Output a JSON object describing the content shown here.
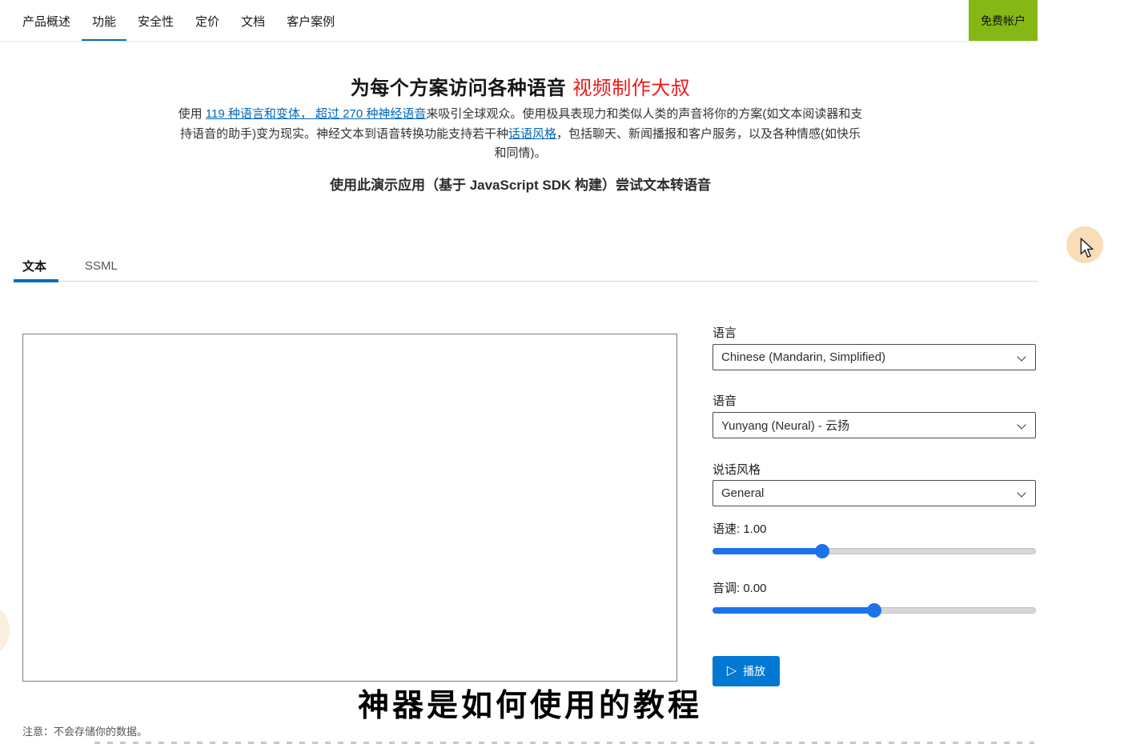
{
  "nav": {
    "items": [
      "产品概述",
      "功能",
      "安全性",
      "定价",
      "文档",
      "客户案例"
    ],
    "active_item": "功能",
    "free_account": "免费帐户"
  },
  "hero": {
    "title": "为每个方案访问各种语音",
    "title_annotation": "视频制作大叔",
    "intro": {
      "seg1": "使用 ",
      "link1": "119 种语言和变体， 超过 270 种神经语音",
      "seg2": "来吸引全球观众。使用极具表现力和类似人类的声音将你的方案(如文本阅读器和支持语音的助手)变为现实。神经文本到语音转换功能支持若干种",
      "link2": "话语风格",
      "seg3": "，包括聊天、新闻播报和客户服务，以及各种情感(如快乐和同情)。"
    },
    "subtitle": "使用此演示应用（基于 JavaScript SDK 构建）尝试文本转语音"
  },
  "tabs": {
    "items": [
      "文本",
      "SSML"
    ],
    "active": "文本"
  },
  "editor": {
    "value": ""
  },
  "controls": {
    "language": {
      "label": "语言",
      "value": "Chinese (Mandarin, Simplified)"
    },
    "voice": {
      "label": "语音",
      "value": "Yunyang (Neural) - 云扬"
    },
    "style": {
      "label": "说话风格",
      "value": "General"
    },
    "rate": {
      "label": "语速: 1.00",
      "value": "1.00",
      "percent": 34
    },
    "pitch": {
      "label": "音调: 0.00",
      "value": "0.00",
      "percent": 50
    },
    "play": {
      "label": "播放",
      "icon": "▷"
    }
  },
  "notice": "注意：不会存储你的数据。",
  "overlay": {
    "watermark": "神器是如何使用的教程"
  },
  "colors": {
    "accent_blue": "#0f6cbd",
    "play_button_blue": "#0078d4",
    "slider_blue": "#1a73e8",
    "link_blue": "#0067b8",
    "free_account_green": "#85b716",
    "annotation_red": "#f01818",
    "highlight_peach": "#f8ddb8"
  }
}
